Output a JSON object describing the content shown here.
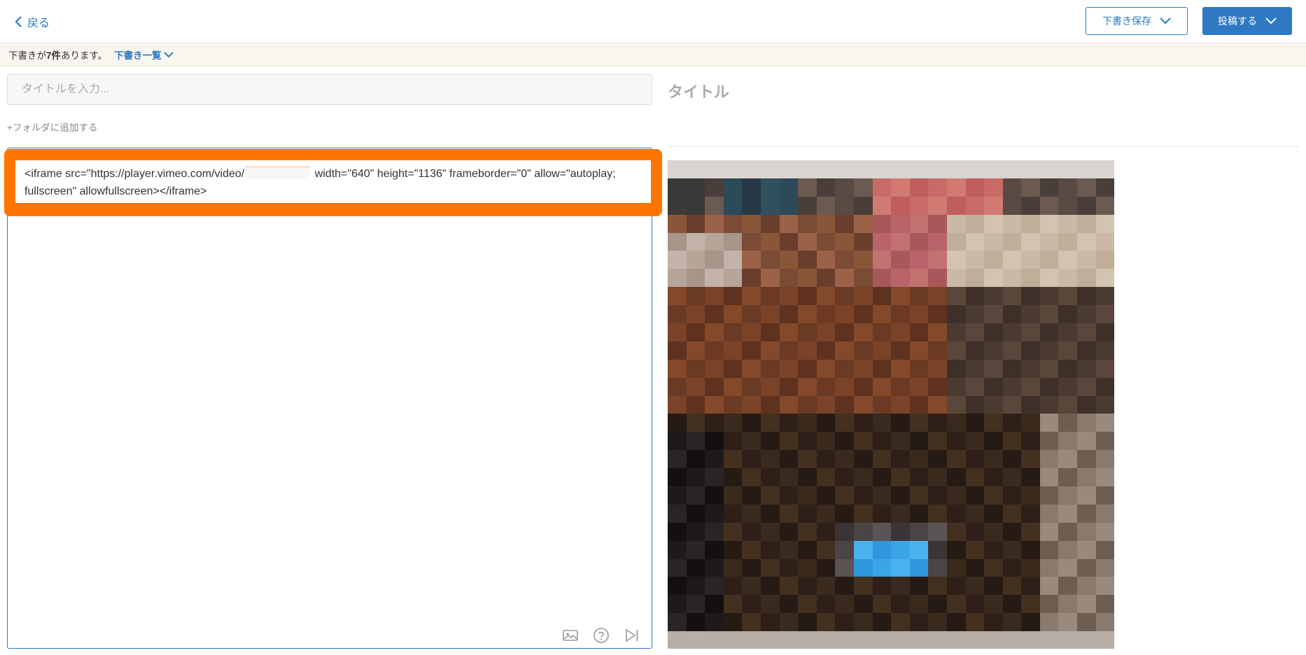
{
  "header": {
    "back_label": "戻る",
    "draft_save_label": "下書き保存",
    "post_label": "投稿する"
  },
  "notice": {
    "prefix": "下書きが",
    "count": "7件",
    "suffix": "あります。",
    "list_link": "下書き一覧"
  },
  "editor": {
    "title_placeholder": "タイトルを入力...",
    "add_folder": "+フォルダに追加する",
    "code_before": "<iframe src=\"https://player.vimeo.com/video/",
    "code_after": " width=\"640\" height=\"1136\" frameborder=\"0\" allow=\"autoplay; fullscreen\" allowfullscreen></iframe>",
    "tools": [
      "image-icon",
      "help-icon",
      "skip-forward-icon"
    ]
  },
  "preview": {
    "title": "タイトル"
  },
  "colors": {
    "accent": "#2f79c4",
    "highlight": "#ff7500",
    "notice_bg": "#f8f6ef"
  }
}
